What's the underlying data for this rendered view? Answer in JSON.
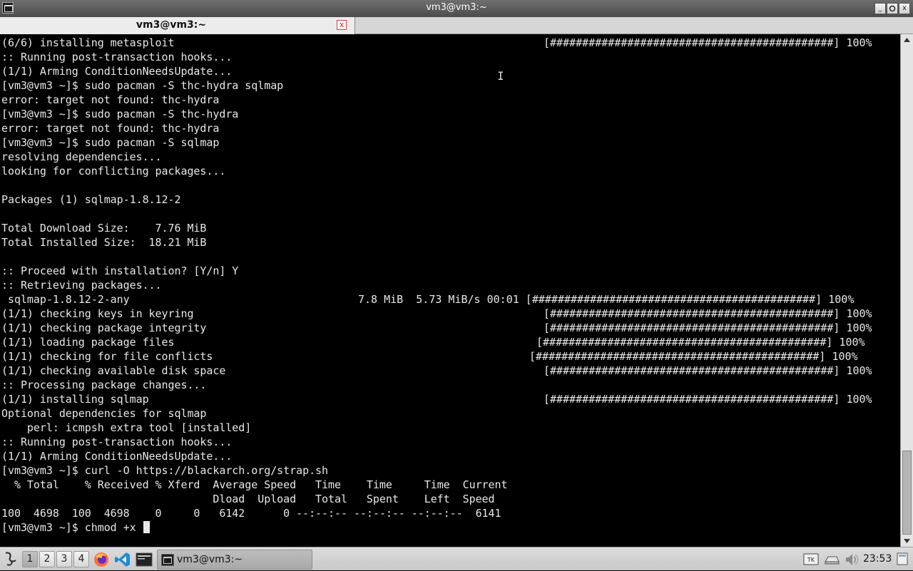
{
  "window": {
    "title": "vm3@vm3:~",
    "buttons": {
      "minimize": "_",
      "maximize": "▫",
      "close": "x"
    }
  },
  "tab": {
    "label": "vm3@vm3:~",
    "close": "x"
  },
  "terminal": {
    "lines": [
      "(6/6) installing metasploit",
      ":: Running post-transaction hooks...",
      "(1/1) Arming ConditionNeedsUpdate...",
      "[vm3@vm3 ~]$ sudo pacman -S thc-hydra sqlmap",
      "error: target not found: thc-hydra",
      "[vm3@vm3 ~]$ sudo pacman -S thc-hydra",
      "error: target not found: thc-hydra",
      "[vm3@vm3 ~]$ sudo pacman -S sqlmap",
      "resolving dependencies...",
      "looking for conflicting packages...",
      "",
      "Packages (1) sqlmap-1.8.12-2",
      "",
      "Total Download Size:    7.76 MiB",
      "Total Installed Size:  18.21 MiB",
      "",
      ":: Proceed with installation? [Y/n] Y",
      ":: Retrieving packages...",
      " sqlmap-1.8.12-2-any",
      "(1/1) checking keys in keyring",
      "(1/1) checking package integrity",
      "(1/1) loading package files",
      "(1/1) checking for file conflicts",
      "(1/1) checking available disk space",
      ":: Processing package changes...",
      "(1/1) installing sqlmap",
      "Optional dependencies for sqlmap",
      "    perl: icmpsh extra tool [installed]",
      ":: Running post-transaction hooks...",
      "(1/1) Arming ConditionNeedsUpdate...",
      "[vm3@vm3 ~]$ curl -O https://blackarch.org/strap.sh",
      "  % Total    % Received % Xferd  Average Speed   Time    Time     Time  Current",
      "                                 Dload  Upload   Total   Spent    Left  Speed",
      "100  4698  100  4698    0     0   6142      0 --:--:-- --:--:-- --:--:--  6141"
    ],
    "prompt_line": "[vm3@vm3 ~]$ chmod +x ",
    "progress_rows": [
      {
        "text": "[############################################] 100%"
      },
      {
        "text": "7.8 MiB  5.73 MiB/s 00:01 [############################################] 100%"
      },
      {
        "text": "[############################################] 100%"
      },
      {
        "text": "[############################################] 100%"
      },
      {
        "text": "[############################################] 100%"
      },
      {
        "text": "[############################################] 100%"
      },
      {
        "text": "[############################################] 100%"
      },
      {
        "text": "[############################################] 100%"
      }
    ],
    "text_cursor_glyph": "I"
  },
  "taskbar": {
    "workspaces": [
      "1",
      "2",
      "3",
      "4"
    ],
    "active_workspace": "1",
    "task_label": "vm3@vm3:~",
    "clock": "23:53"
  }
}
